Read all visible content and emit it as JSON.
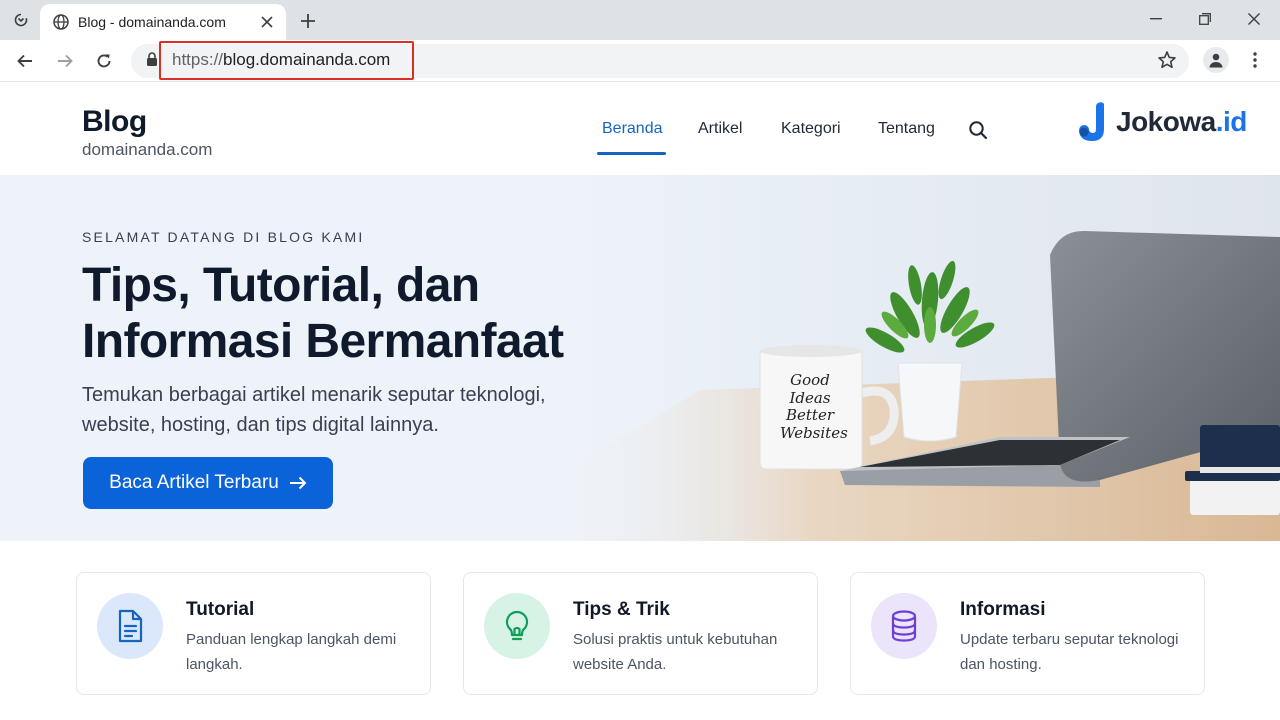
{
  "browser": {
    "tab_title": "Blog - domainanda.com",
    "url_scheme": "https://",
    "url_host": "blog.domainanda.com"
  },
  "site": {
    "brand_title": "Blog",
    "brand_subtitle": "domainanda.com",
    "nav": [
      {
        "label": "Beranda",
        "active": true
      },
      {
        "label": "Artikel",
        "active": false
      },
      {
        "label": "Kategori",
        "active": false
      },
      {
        "label": "Tentang",
        "active": false
      }
    ],
    "logo_text_main": "Jokowa",
    "logo_text_suffix": ".id"
  },
  "hero": {
    "eyebrow": "SELAMAT DATANG DI BLOG KAMI",
    "title_line1": "Tips, Tutorial, dan",
    "title_line2": "Informasi Bermanfaat",
    "desc_line1": "Temukan berbagai artikel menarik seputar teknologi,",
    "desc_line2": "website, hosting, dan tips digital lainnya.",
    "cta_label": "Baca Artikel Terbaru",
    "mug_text": [
      "Good",
      "Ideas",
      "Better",
      "Websites"
    ]
  },
  "cards": [
    {
      "title": "Tutorial",
      "desc_line1": "Panduan lengkap langkah demi",
      "desc_line2": "langkah.",
      "icon": "document-icon",
      "color": "#1565c0",
      "bg": "#dbe8fb"
    },
    {
      "title": "Tips & Trik",
      "desc_line1": "Solusi praktis untuk kebutuhan",
      "desc_line2": "website Anda.",
      "icon": "lightbulb-icon",
      "color": "#0f9d58",
      "bg": "#d7f3e6"
    },
    {
      "title": "Informasi",
      "desc_line1": "Update terbaru seputar teknologi",
      "desc_line2": "dan hosting.",
      "icon": "database-icon",
      "color": "#6d3fd6",
      "bg": "#ebe4fb"
    }
  ],
  "colors": {
    "accent": "#1565c0",
    "cta": "#0b63d9",
    "url_highlight": "#d93025"
  }
}
